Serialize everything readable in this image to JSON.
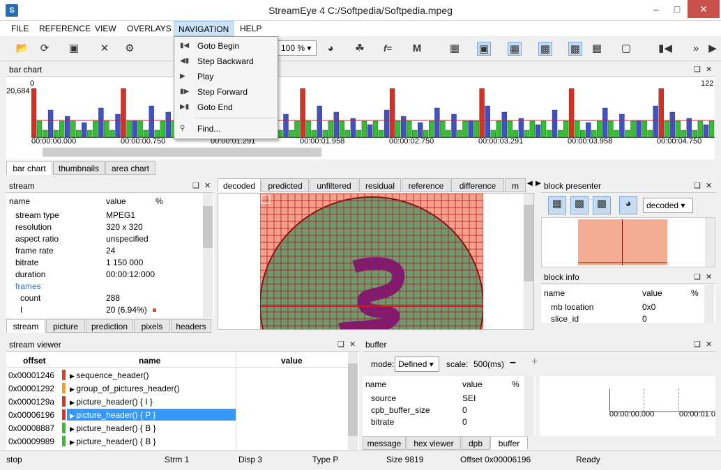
{
  "window": {
    "title": "StreamEye 4 C:/Softpedia/Softpedia.mpeg",
    "app_icon": "S"
  },
  "menu": {
    "items": [
      "FILE",
      "REFERENCE",
      "VIEW",
      "OVERLAYS",
      "NAVIGATION",
      "HELP"
    ]
  },
  "toolbar": {
    "zoom": "100 %",
    "func_label": "f="
  },
  "nav_menu": {
    "items": [
      "Goto Begin",
      "Step Backward",
      "Play",
      "Step Forward",
      "Goto End",
      "Find..."
    ]
  },
  "bar_chart": {
    "title": "bar chart",
    "y_max": "20,684",
    "top_left": "0",
    "top_right": "122",
    "time_labels": [
      "00:00:00.000",
      "00:00:00.750",
      "00:00:01.291",
      "00:00:01.958",
      "00:00:02.750",
      "00:00:03.291",
      "00:00:03.958",
      "00:00:04.750"
    ],
    "tabs": [
      "bar chart",
      "thumbnails",
      "area chart"
    ]
  },
  "stream": {
    "title": "stream",
    "headers": [
      "name",
      "value",
      "%"
    ],
    "rows": [
      {
        "name": "stream type",
        "value": "MPEG1"
      },
      {
        "name": "resolution",
        "value": "320 x 320"
      },
      {
        "name": "aspect ratio",
        "value": "unspecified"
      },
      {
        "name": "frame rate",
        "value": "24"
      },
      {
        "name": "bitrate",
        "value": "1 150 000"
      },
      {
        "name": "duration",
        "value": "00:00:12:000"
      },
      {
        "name": "frames",
        "value": ""
      },
      {
        "name": "count",
        "value": "288"
      },
      {
        "name": "I",
        "value": "20 (6.94%)"
      }
    ],
    "tabs": [
      "stream",
      "picture",
      "prediction",
      "pixels",
      "headers"
    ]
  },
  "view_tabs": [
    "decoded",
    "predicted",
    "unfiltered",
    "residual",
    "reference",
    "difference",
    "m"
  ],
  "block_presenter": {
    "title": "block presenter",
    "mode": "decoded"
  },
  "block_info": {
    "title": "block info",
    "headers": [
      "name",
      "value",
      "%"
    ],
    "rows": [
      {
        "name": "mb location",
        "value": "0x0"
      },
      {
        "name": "slice_id",
        "value": "0"
      }
    ]
  },
  "stream_viewer": {
    "title": "stream viewer",
    "headers": [
      "offset",
      "name",
      "value"
    ],
    "rows": [
      {
        "offset": "0x00001246",
        "name": "sequence_header()",
        "color": "#e04020"
      },
      {
        "offset": "0x00001292",
        "name": "group_of_pictures_header()",
        "color": "#f0a020"
      },
      {
        "offset": "0x0000129a",
        "name": "picture_header() { I }",
        "color": "#e03020"
      },
      {
        "offset": "0x00006196",
        "name": "picture_header() { P }",
        "color": "#e03020"
      },
      {
        "offset": "0x00008887",
        "name": "picture_header() { B }",
        "color": "#30c030"
      },
      {
        "offset": "0x00009989",
        "name": "picture_header() { B }",
        "color": "#30c030"
      }
    ]
  },
  "buffer": {
    "title": "buffer",
    "mode_label": "mode:",
    "mode": "Defined",
    "scale_label": "scale:",
    "scale": "500(ms)",
    "headers": [
      "name",
      "value",
      "%"
    ],
    "rows": [
      {
        "name": "source",
        "value": "SEI"
      },
      {
        "name": "cpb_buffer_size",
        "value": "0"
      },
      {
        "name": "bitrate",
        "value": "0"
      }
    ],
    "time_labels": [
      "00:00:00.000",
      "00:00:01.0"
    ],
    "tabs": [
      "message",
      "hex viewer",
      "dpb",
      "buffer"
    ]
  },
  "status": {
    "state": "stop",
    "strm": "Strm 1",
    "disp": "Disp 3",
    "type": "Type P",
    "size": "Size 9819",
    "offset": "Offset 0x00006196",
    "ready": "Ready"
  }
}
